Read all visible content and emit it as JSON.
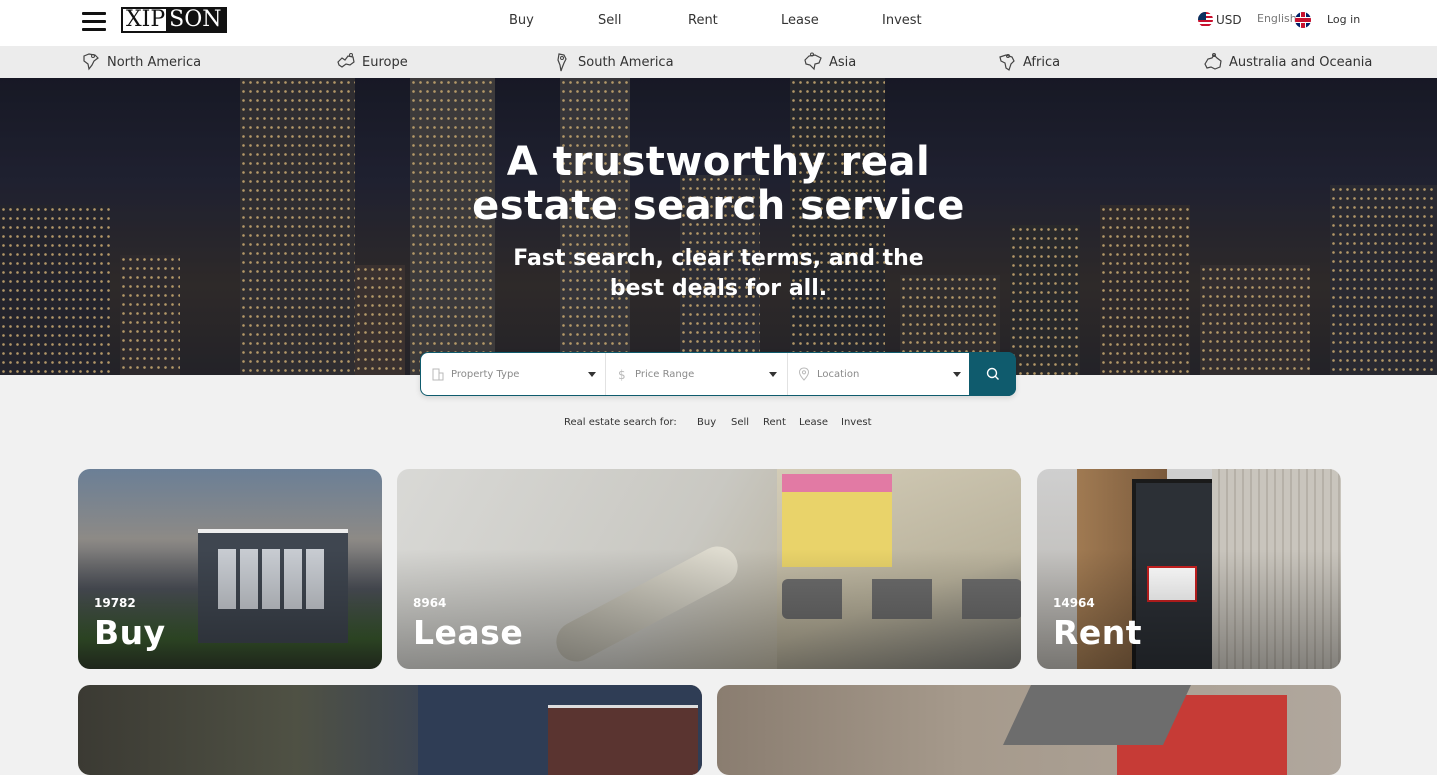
{
  "header": {
    "logo_left": "XIP",
    "logo_right": "SON",
    "nav": [
      "Buy",
      "Sell",
      "Rent",
      "Lease",
      "Invest"
    ],
    "currency": "USD",
    "language": "English",
    "login": "Log in"
  },
  "regions": [
    {
      "label": "North America",
      "icon": "north-america-map-icon"
    },
    {
      "label": "Europe",
      "icon": "europe-map-icon"
    },
    {
      "label": "South America",
      "icon": "south-america-map-icon"
    },
    {
      "label": "Asia",
      "icon": "asia-map-icon"
    },
    {
      "label": "Africa",
      "icon": "africa-map-icon"
    },
    {
      "label": "Australia and Oceania",
      "icon": "australia-map-icon"
    }
  ],
  "hero": {
    "title_line1": "A trustworthy real",
    "title_line2": "estate search service",
    "subtitle_line1": "Fast search, clear terms, and the",
    "subtitle_line2": "best deals for all."
  },
  "search": {
    "property_type": "Property Type",
    "price_range": "Price Range",
    "location": "Location"
  },
  "quick": {
    "label": "Real estate search for:",
    "links": [
      "Buy",
      "Sell",
      "Rent",
      "Lease",
      "Invest"
    ]
  },
  "cards": [
    {
      "count": "19782",
      "name": "Buy"
    },
    {
      "count": "8964",
      "name": "Lease"
    },
    {
      "count": "14964",
      "name": "Rent"
    }
  ],
  "colors": {
    "accent": "#0f5b6d",
    "header_bg": "#ffffff",
    "region_bg": "#ececec",
    "page_bg": "#f1f1f1"
  }
}
